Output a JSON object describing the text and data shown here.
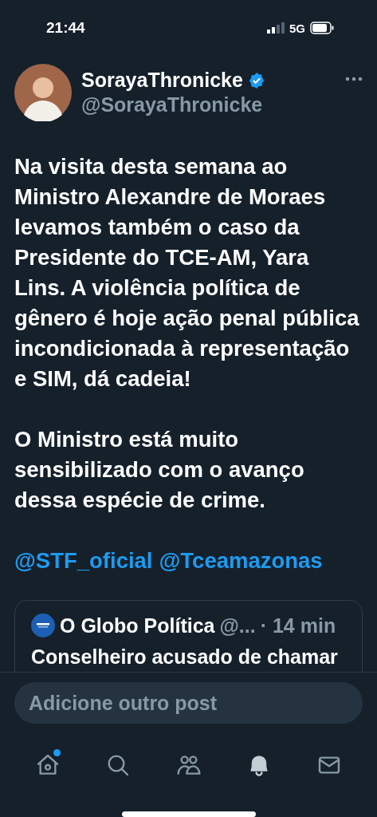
{
  "status_bar": {
    "time": "21:44",
    "network": "5G"
  },
  "post": {
    "author": {
      "name": "SorayaThronicke",
      "handle": "@SorayaThronicke",
      "verified": true
    },
    "paragraphs": [
      "Na visita desta semana ao Ministro Alexandre de Moraes levamos também o caso da Presidente do TCE-AM, Yara Lins. A violência política de gênero é hoje ação penal pública incondicionada à representação e SIM, dá cadeia!",
      "O Ministro está muito sensibilizado com o avanço dessa espécie de crime."
    ],
    "mentions": [
      "@STF_oficial",
      "@Tceamazonas"
    ],
    "quote": {
      "name": "O Globo Política",
      "handle": "@...",
      "time": "· 14 min",
      "text": "Conselheiro acusado de chamar"
    }
  },
  "composer": {
    "placeholder": "Adicione outro post"
  },
  "nav": [
    {
      "kind": "home",
      "selected": false,
      "badge": true
    },
    {
      "kind": "search",
      "selected": false,
      "badge": false
    },
    {
      "kind": "communities",
      "selected": false,
      "badge": false
    },
    {
      "kind": "notifications",
      "selected": true,
      "badge": false
    },
    {
      "kind": "messages",
      "selected": false,
      "badge": false
    }
  ]
}
